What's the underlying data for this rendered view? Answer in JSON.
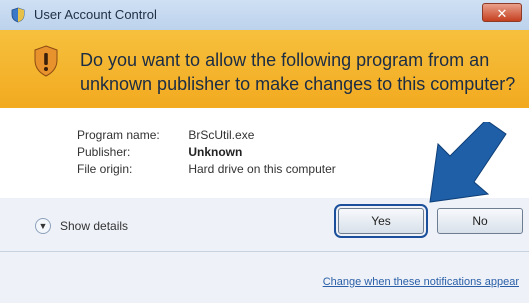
{
  "window": {
    "title": "User Account Control",
    "close_label": "✕"
  },
  "banner": {
    "message": "Do you want to allow the following program from an unknown publisher to make changes to this computer?"
  },
  "details": {
    "program_name_label": "Program name:",
    "program_name_value": "BrScUtil.exe",
    "publisher_label": "Publisher:",
    "publisher_value": "Unknown",
    "file_origin_label": "File origin:",
    "file_origin_value": "Hard drive on this computer"
  },
  "footer": {
    "show_details": "Show details",
    "yes_label": "Yes",
    "no_label": "No",
    "change_link": "Change when these notifications appear"
  },
  "colors": {
    "banner": "#f2aa20",
    "arrow": "#1e5fa8"
  }
}
